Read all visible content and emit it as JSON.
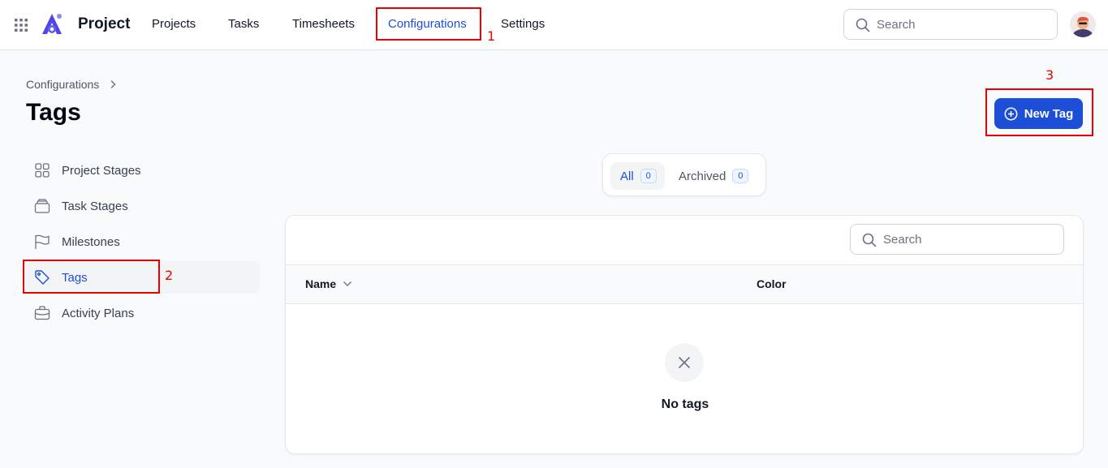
{
  "app": {
    "title": "Project"
  },
  "nav": {
    "items": [
      {
        "label": "Projects"
      },
      {
        "label": "Tasks"
      },
      {
        "label": "Timesheets"
      },
      {
        "label": "Configurations"
      },
      {
        "label": "Settings"
      }
    ],
    "active": "Configurations"
  },
  "top_search": {
    "placeholder": "Search"
  },
  "breadcrumb": {
    "parent": "Configurations"
  },
  "page": {
    "title": "Tags"
  },
  "actions": {
    "new_tag_label": "New Tag"
  },
  "sidebar": {
    "items": [
      {
        "label": "Project Stages",
        "icon": "grid-icon"
      },
      {
        "label": "Task Stages",
        "icon": "stack-icon"
      },
      {
        "label": "Milestones",
        "icon": "flag-icon"
      },
      {
        "label": "Tags",
        "icon": "tag-icon"
      },
      {
        "label": "Activity Plans",
        "icon": "briefcase-icon"
      }
    ],
    "active": "Tags"
  },
  "filter_tabs": [
    {
      "label": "All",
      "count": "0"
    },
    {
      "label": "Archived",
      "count": "0"
    }
  ],
  "table": {
    "search_placeholder": "Search",
    "columns": [
      {
        "label": "Name"
      },
      {
        "label": "Color"
      }
    ],
    "empty_text": "No tags"
  },
  "annotations": [
    "1",
    "2",
    "3"
  ],
  "colors": {
    "accent": "#1d4ed8",
    "annotation": "#ee0000"
  }
}
